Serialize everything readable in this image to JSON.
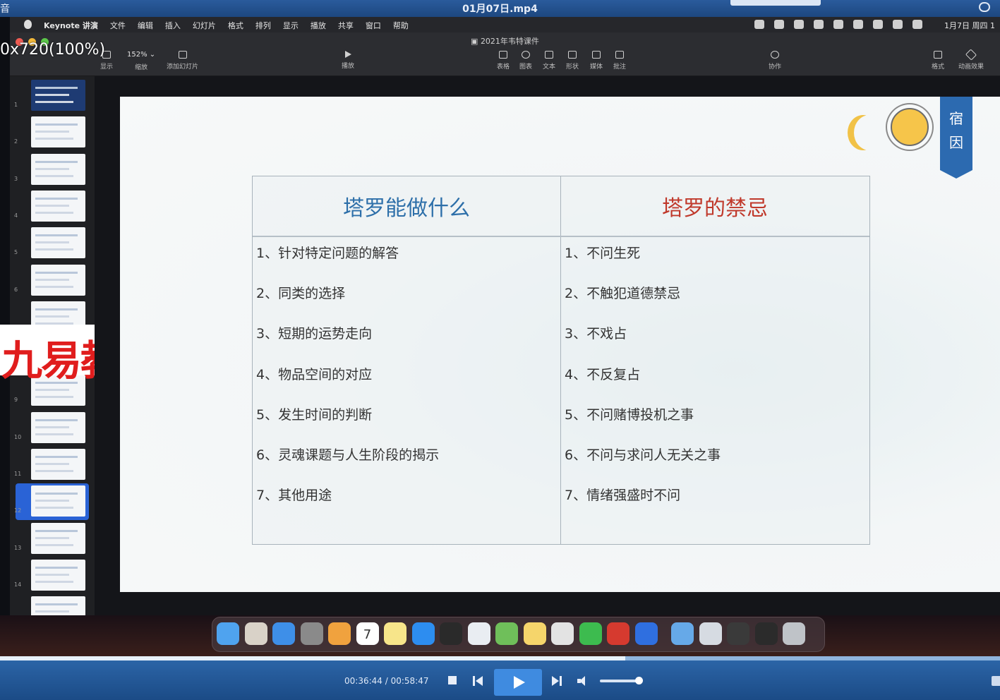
{
  "player": {
    "app_name": "音",
    "file_name": "01月07日.mp4",
    "time_display": "00:36:44 / 00:58:47",
    "progress_fraction": 0.625,
    "volume_fraction": 0.95
  },
  "menubar": {
    "items": [
      "Keynote 讲演",
      "文件",
      "编辑",
      "插入",
      "幻灯片",
      "格式",
      "排列",
      "显示",
      "播放",
      "共享",
      "窗口",
      "帮助"
    ],
    "clock": "1月7日 周四 1"
  },
  "toolbar": {
    "document_title": "2021年韦特课件",
    "zoom": "152%",
    "labels": {
      "view": "显示",
      "zoom": "缩放",
      "add_slide": "添加幻灯片",
      "play": "播放",
      "table": "表格",
      "chart": "图表",
      "text": "文本",
      "shape": "形状",
      "media": "媒体",
      "comment": "批注",
      "collaborate": "协作",
      "format": "格式",
      "animate": "动画效果"
    }
  },
  "overlay": {
    "resolution": "0x720(100%)",
    "watermark": "九易教程"
  },
  "navigator": {
    "selected": "12",
    "slides": [
      "1",
      "2",
      "3",
      "4",
      "5",
      "6",
      "",
      "",
      "9",
      "10",
      "11",
      "12",
      "13",
      "14",
      ""
    ]
  },
  "slide": {
    "ribbon_chars": [
      "宿",
      "因"
    ],
    "left_header": "塔罗能做什么",
    "right_header": "塔罗的禁忌",
    "left_items": [
      "1、针对特定问题的解答",
      "2、同类的选择",
      "3、短期的运势走向",
      "4、物品空间的对应",
      "5、发生时间的判断",
      "6、灵魂课题与人生阶段的揭示",
      "7、其他用途"
    ],
    "right_items": [
      "1、不问生死",
      "2、不触犯道德禁忌",
      "3、不戏占",
      "4、不反复占",
      "5、不问赌博投机之事",
      "6、不问与求问人无关之事",
      "7、情绪强盛时不问"
    ]
  },
  "dock": {
    "apps": [
      "finder-icon",
      "launchpad-icon",
      "safari-icon",
      "system-preferences-icon",
      "photos-icon",
      "calendar-icon",
      "notes-icon",
      "app-store-icon",
      "keynote-icon",
      "preview-icon",
      "maps-icon",
      "pages-icon",
      "chrome-icon",
      "wechat-icon",
      "wps-icon",
      "feishu-icon",
      "folder-icon",
      "screenshot-icon",
      "iphone-icon",
      "monitor-icon",
      "trash-icon"
    ],
    "calendar_day": "7"
  }
}
